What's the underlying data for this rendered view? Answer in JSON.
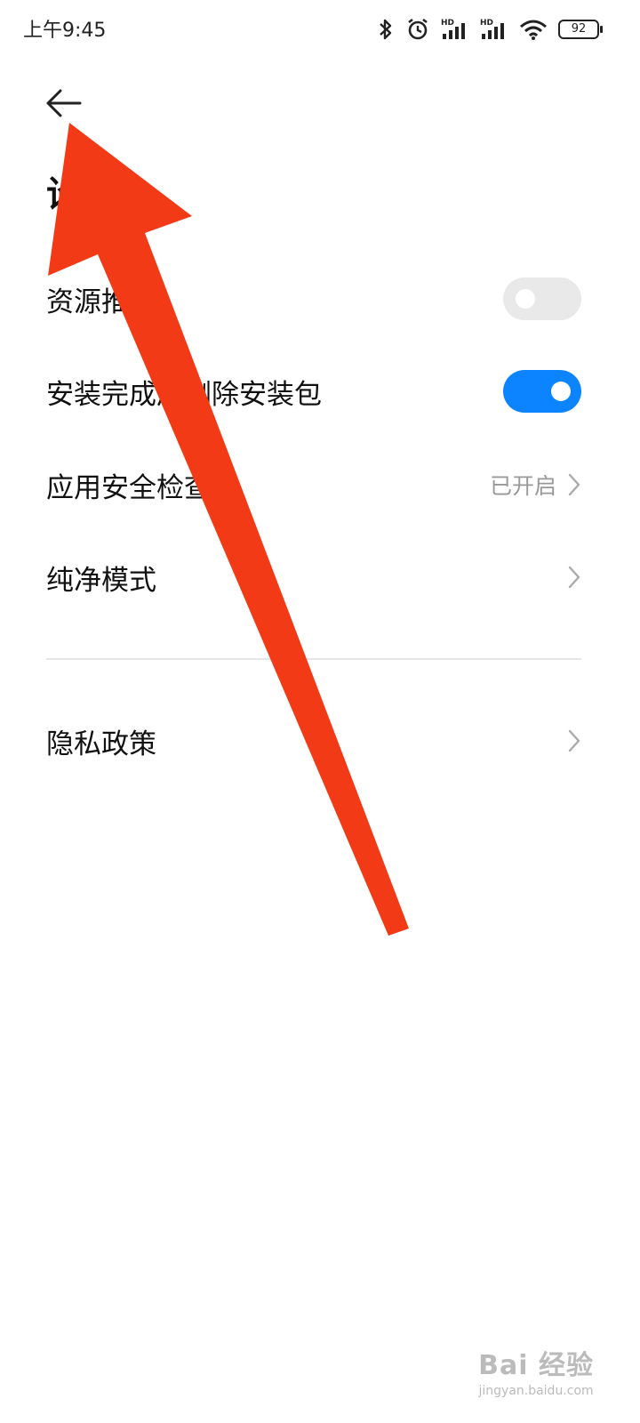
{
  "status_bar": {
    "time": "上午9:45",
    "battery": "92",
    "icons": [
      "bluetooth-icon",
      "alarm-icon",
      "hd-signal-icon",
      "hd-signal-icon",
      "wifi-icon",
      "battery-icon"
    ]
  },
  "header": {
    "back_icon": "arrow-left-icon",
    "title": "设置"
  },
  "settings": {
    "items": [
      {
        "label": "资源推荐",
        "control": "toggle",
        "on": false
      },
      {
        "label": "安装完成后删除安装包",
        "control": "toggle",
        "on": true
      },
      {
        "label": "应用安全检查",
        "value": "已开启",
        "control": "chevron"
      },
      {
        "label": "纯净模式",
        "control": "chevron"
      },
      {
        "label": "隐私政策",
        "control": "chevron"
      }
    ]
  },
  "colors": {
    "accent": "#0d84ff",
    "toggle_off": "#e9e9e9",
    "annotation_arrow": "#f23a16",
    "secondary_text": "#999999"
  },
  "watermark": {
    "logo": "Bai 经验",
    "url": "jingyan.baidu.com"
  }
}
